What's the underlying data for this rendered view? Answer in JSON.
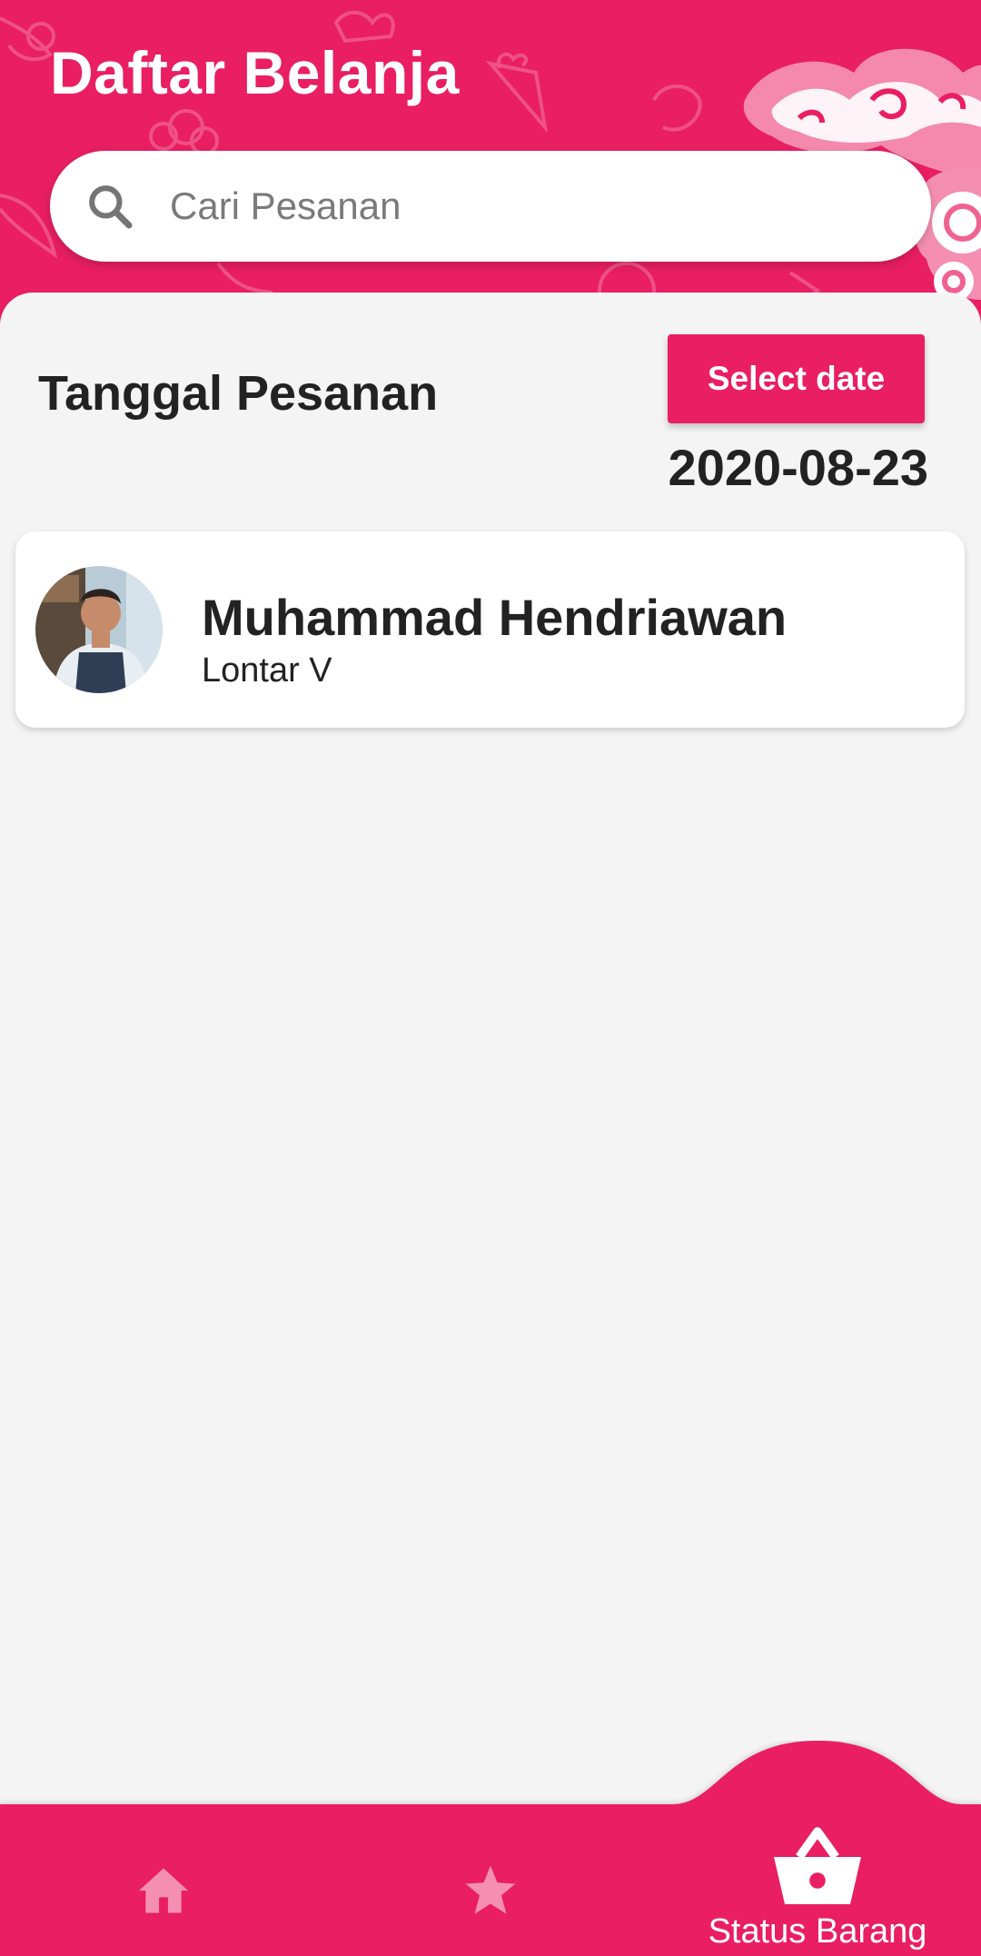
{
  "app": {
    "title": "Daftar Belanja"
  },
  "search": {
    "placeholder": "Cari Pesanan",
    "value": ""
  },
  "filter": {
    "section_title": "Tanggal Pesanan",
    "select_date_label": "Select date",
    "selected_date": "2020-08-23"
  },
  "orders": [
    {
      "name": "Muhammad Hendriawan",
      "address": "Lontar V"
    }
  ],
  "nav": {
    "items": [
      {
        "icon": "home-icon",
        "label": ""
      },
      {
        "icon": "star-icon",
        "label": ""
      },
      {
        "icon": "basket-icon",
        "label": "Status Barang"
      }
    ]
  },
  "colors": {
    "primary": "#e91e63",
    "background": "#f4f4f4",
    "inactive_icon": "#f48fb1"
  }
}
